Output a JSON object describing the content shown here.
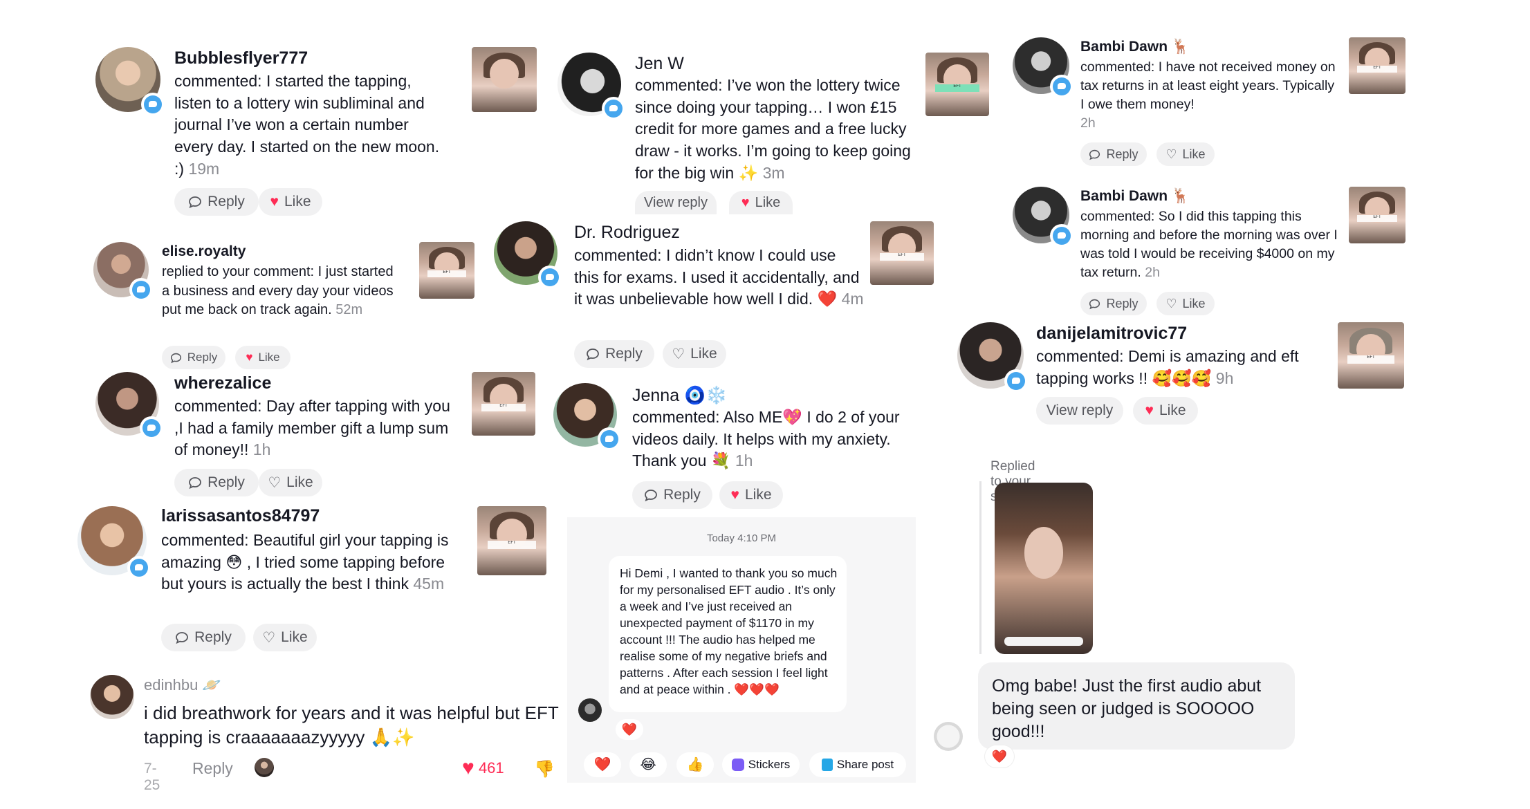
{
  "column1": [
    {
      "username": "Bubblesflyer777",
      "text": "commented: I started the tapping, listen to a lottery win subliminal and journal I’ve won a certain number every day. I started on the new moon. :)",
      "time": "19m",
      "reply": "Reply",
      "like": "Like"
    },
    {
      "username": "elise.royalty",
      "text": "replied to your comment: I just started a business and every day your videos put me back on track again.",
      "time": "52m",
      "reply": "Reply",
      "like": "Like"
    },
    {
      "username": "wherezalice",
      "text": "commented: Day after tapping with you ,I had a family member gift a lump sum of money!!",
      "time": "1h",
      "reply": "Reply",
      "like": "Like"
    },
    {
      "username": "larissasantos84797",
      "text": "commented: Beautiful girl your tapping is amazing 😳 , I tried some tapping before but yours is actually the best I think",
      "time": "45m",
      "reply": "Reply",
      "like": "Like"
    }
  ],
  "edin": {
    "username": "edinhbu 🪐",
    "text": "i did breathwork for years and it was helpful but EFT tapping is craaaaaaazyyyyy 🙏✨",
    "date": "7-25",
    "reply": "Reply",
    "likes": "461"
  },
  "column2": [
    {
      "username": "Jen W",
      "text": "commented: I’ve won the lottery twice since doing your tapping… I won £15 credit for more games and a free lucky draw - it works. I’m going to keep going for the big win ✨",
      "time": "3m",
      "view_reply": "View reply",
      "like": "Like"
    },
    {
      "username": "Dr. Rodriguez",
      "text": "commented: I didn’t know I could use this for exams. I used it accidentally, and it was unbelievable how well I did. ❤️",
      "time": "4m",
      "reply": "Reply",
      "like": "Like"
    },
    {
      "username": "Jenna 🧿❄️",
      "text": "commented: Also ME💖 I do 2 of your videos daily. It helps with my anxiety. Thank you 💐",
      "time": "1h",
      "reply": "Reply",
      "like": "Like"
    }
  ],
  "dm": {
    "timestamp": "Today 4:10 PM",
    "message": "Hi Demi , I wanted to thank you so much for my personalised EFT audio . It’s only a week and I’ve just received an unexpected payment of $1170 in my account !!! The audio has helped me realise some of my negative briefs and patterns . After each session I feel light and at peace within .  ❤️❤️❤️",
    "reaction": "❤️",
    "quick": [
      "❤️",
      "😂",
      "👍"
    ],
    "stickers": "Stickers",
    "share_post": "Share post"
  },
  "column3": [
    {
      "username": "Bambi Dawn 🦌",
      "text": "commented: I have not received money on tax returns in at least eight years. Typically I owe them money!",
      "time": "2h",
      "reply": "Reply",
      "like": "Like"
    },
    {
      "username": "Bambi Dawn 🦌",
      "text": "commented: So I did this tapping this morning and before the morning was over I was told I would be receiving $4000 on my tax return.",
      "time": "2h",
      "reply": "Reply",
      "like": "Like"
    },
    {
      "username": "danijelamitrovic77",
      "text": "commented: Demi is amazing and eft tapping works !! 🥰🥰🥰",
      "time": "9h",
      "view_reply": "View reply",
      "like": "Like"
    }
  ],
  "story": {
    "label": "Replied to your story",
    "message": "Omg babe! Just the first audio abut being seen or judged is SOOOOO good!!!",
    "reaction": "❤️"
  },
  "icons": {
    "badge": "comment-badge-icon",
    "heart": "heart-icon",
    "reply": "reply-icon"
  },
  "colors": {
    "like_red": "#fe2c55",
    "badge_blue": "#45a6ee",
    "pill_bg": "#f1f1f2"
  }
}
